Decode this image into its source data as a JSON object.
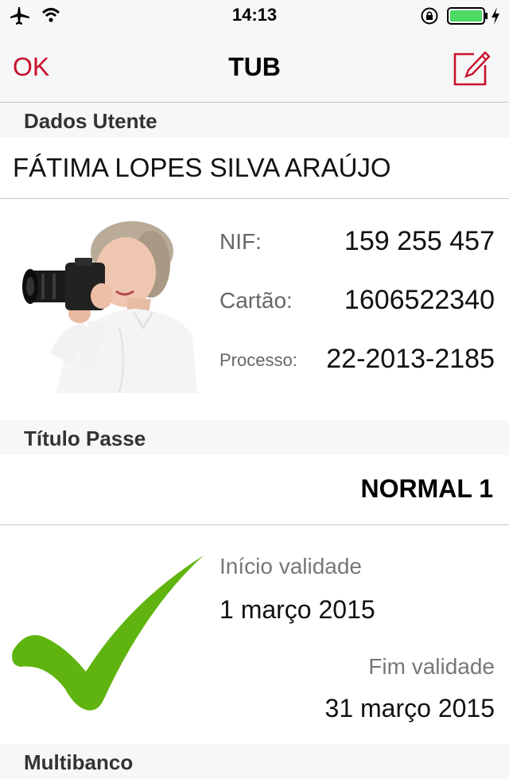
{
  "status_bar": {
    "time": "14:13",
    "icons": [
      "airplane-icon",
      "wifi-icon",
      "rotation-lock-icon",
      "battery-icon",
      "charging-icon"
    ],
    "battery_color": "#4cd964"
  },
  "nav": {
    "ok_label": "OK",
    "title": "TUB",
    "accent_color": "#c8102e",
    "edit_icon": "edit-icon"
  },
  "user_section": {
    "header": "Dados Utente",
    "name": "FÁTIMA LOPES SILVA ARAÚJO",
    "fields": [
      {
        "label": "NIF:",
        "value": "159 255 457"
      },
      {
        "label": "Cartão:",
        "value": "1606522340"
      },
      {
        "label": "Processo:",
        "value": "22-2013-2185"
      }
    ]
  },
  "pass_section": {
    "header": "Título Passe",
    "type": "NORMAL 1",
    "status_icon": "check-icon",
    "check_color": "#5fb40f",
    "start_label": "Início validade",
    "start_date": "1 março 2015",
    "end_label": "Fim validade",
    "end_date": "31 março 2015"
  },
  "next_section": {
    "header": "Multibanco"
  }
}
